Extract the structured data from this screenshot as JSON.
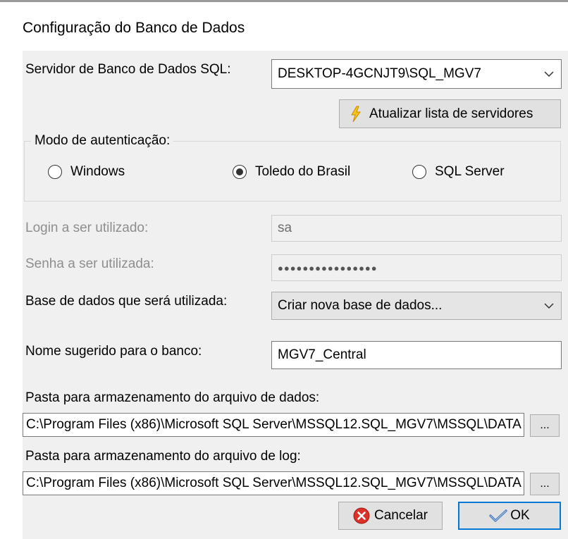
{
  "dialog": {
    "title": "Configuração do Banco de Dados"
  },
  "server": {
    "label": "Servidor de Banco de Dados SQL:",
    "value": "DESKTOP-4GCNJT9\\SQL_MGV7",
    "refresh_label": "Atualizar lista de servidores"
  },
  "auth": {
    "legend": "Modo de autenticação:",
    "options": [
      {
        "label": "Windows",
        "selected": false
      },
      {
        "label": "Toledo do Brasil",
        "selected": true
      },
      {
        "label": "SQL Server",
        "selected": false
      }
    ]
  },
  "login": {
    "label": "Login a ser utilizado:",
    "value": "sa"
  },
  "password": {
    "label": "Senha a ser utilizada:",
    "value": "●●●●●●●●●●●●●●●●"
  },
  "database": {
    "label": "Base de dados que será utilizada:",
    "value": "Criar nova base de dados..."
  },
  "db_name": {
    "label": "Nome sugerido para o banco:",
    "value": "MGV7_Central"
  },
  "data_path": {
    "label": "Pasta para armazenamento do arquivo de dados:",
    "value": "C:\\Program Files (x86)\\Microsoft SQL Server\\MSSQL12.SQL_MGV7\\MSSQL\\DATA",
    "browse_label": "..."
  },
  "log_path": {
    "label": "Pasta para armazenamento do arquivo de log:",
    "value": "C:\\Program Files (x86)\\Microsoft SQL Server\\MSSQL12.SQL_MGV7\\MSSQL\\DATA",
    "browse_label": "..."
  },
  "actions": {
    "cancel_label": "Cancelar",
    "ok_label": "OK"
  },
  "icons": {
    "refresh": "lightning-icon",
    "cancel": "cancel-icon",
    "ok": "checkmark-icon",
    "dropdown": "chevron-down-icon"
  }
}
